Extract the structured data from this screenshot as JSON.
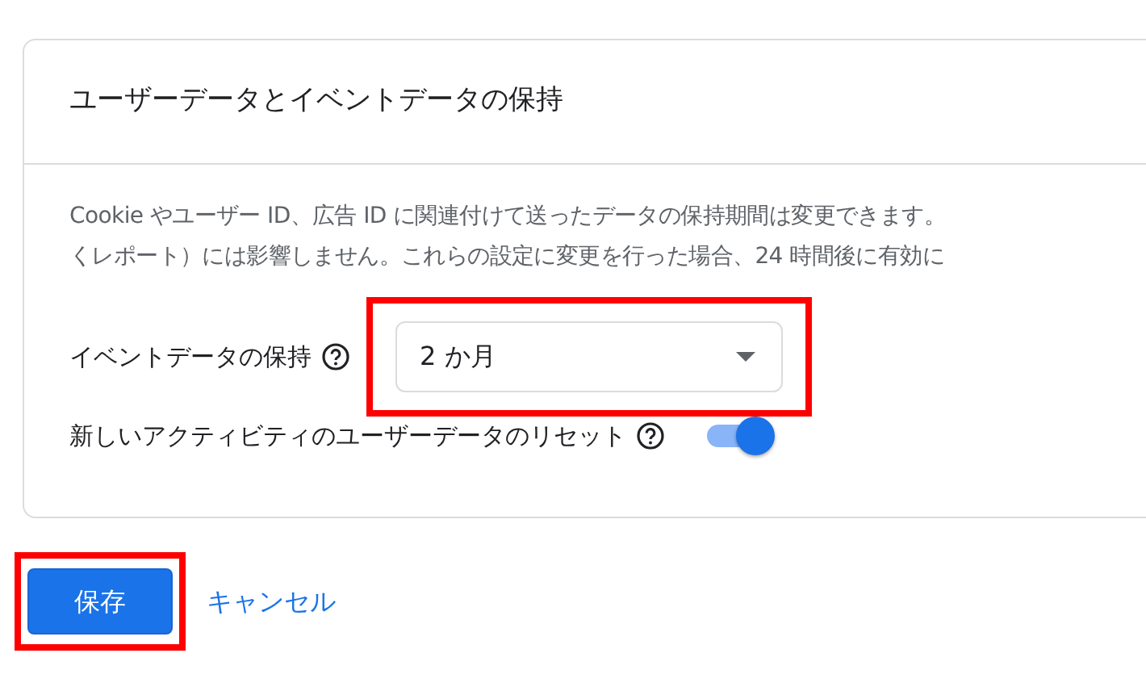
{
  "card": {
    "title": "ユーザーデータとイベントデータの保持",
    "description": [
      "Cookie やユーザー ID、広告 ID に関連付けて送ったデータの保持期間は変更できます。",
      "くレポート）には影響しません。これらの設定に変更を行った場合、24 時間後に有効に"
    ],
    "event_retention": {
      "label": "イベントデータの保持",
      "value": "2 か月",
      "highlighted": true
    },
    "reset_user_data": {
      "label": "新しいアクティビティのユーザーデータのリセット",
      "on": true
    }
  },
  "buttons": [
    {
      "label": "保存",
      "kind": "primary",
      "highlighted": true
    },
    {
      "label": "キャンセル",
      "kind": "link",
      "highlighted": false
    }
  ]
}
